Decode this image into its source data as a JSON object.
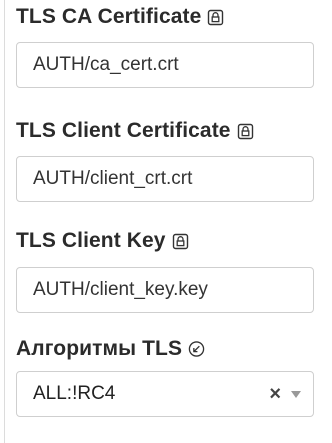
{
  "fields": {
    "ca_cert": {
      "label": "TLS CA Certificate",
      "value": "AUTH/ca_cert.crt",
      "icon": "lock-icon"
    },
    "client_cert": {
      "label": "TLS Client Certificate",
      "value": "AUTH/client_crt.crt",
      "icon": "lock-icon"
    },
    "client_key": {
      "label": "TLS Client Key",
      "value": "AUTH/client_key.key",
      "icon": "lock-icon"
    },
    "tls_algorithms": {
      "label": "Алгоритмы TLS",
      "value": "ALL:!RC4",
      "icon": "arrow-down-left-circle-icon",
      "clear": "×"
    }
  }
}
